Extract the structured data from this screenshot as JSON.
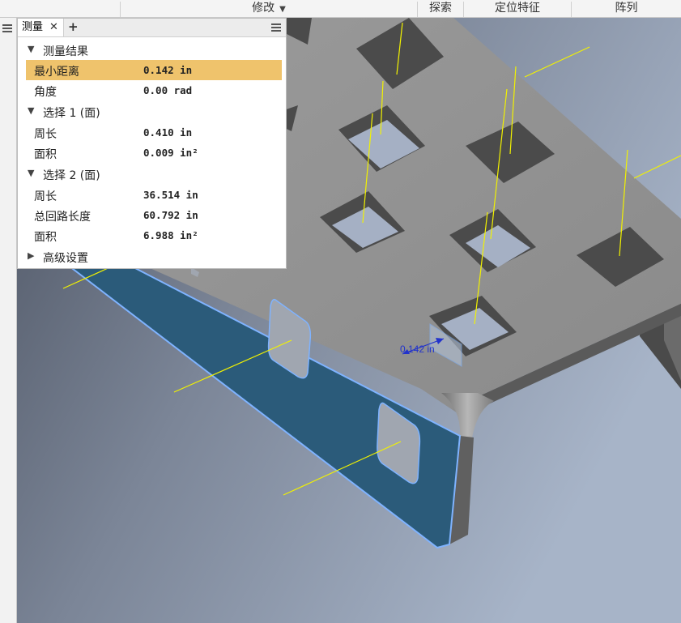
{
  "ribbon": {
    "groups": [
      {
        "label": "修改",
        "has_dropdown": true
      },
      {
        "label": "探索"
      },
      {
        "label": "定位特征"
      },
      {
        "label": "阵列"
      }
    ]
  },
  "palette": {
    "tab_label": "测量",
    "close_glyph": "✕",
    "add_glyph": "+",
    "sections": {
      "results": {
        "header": "测量结果",
        "rows": [
          {
            "label": "最小距离",
            "value": "0.142 in"
          },
          {
            "label": "角度",
            "value": "0.00 rad"
          }
        ]
      },
      "selection1": {
        "header": "选择 1 (面)",
        "rows": [
          {
            "label": "周长",
            "value": "0.410 in"
          },
          {
            "label": "面积",
            "value": "0.009 in²"
          }
        ]
      },
      "selection2": {
        "header": "选择 2 (面)",
        "rows": [
          {
            "label": "周长",
            "value": "36.514 in"
          },
          {
            "label": "总回路长度",
            "value": "60.792 in"
          },
          {
            "label": "面积",
            "value": "6.988 in²"
          }
        ]
      },
      "advanced": {
        "header": "高级设置"
      }
    }
  },
  "viewport": {
    "dimension_label": "0.142 in",
    "colors": {
      "background_dark": "#4b5260",
      "background_light": "#a7b4c8",
      "plate": "#8e8e8e",
      "selected_face": "#2b5b7a",
      "selection_edge": "#7fb3ff",
      "axis_lines": "#f2f200",
      "dimension": "#2233cc"
    }
  }
}
